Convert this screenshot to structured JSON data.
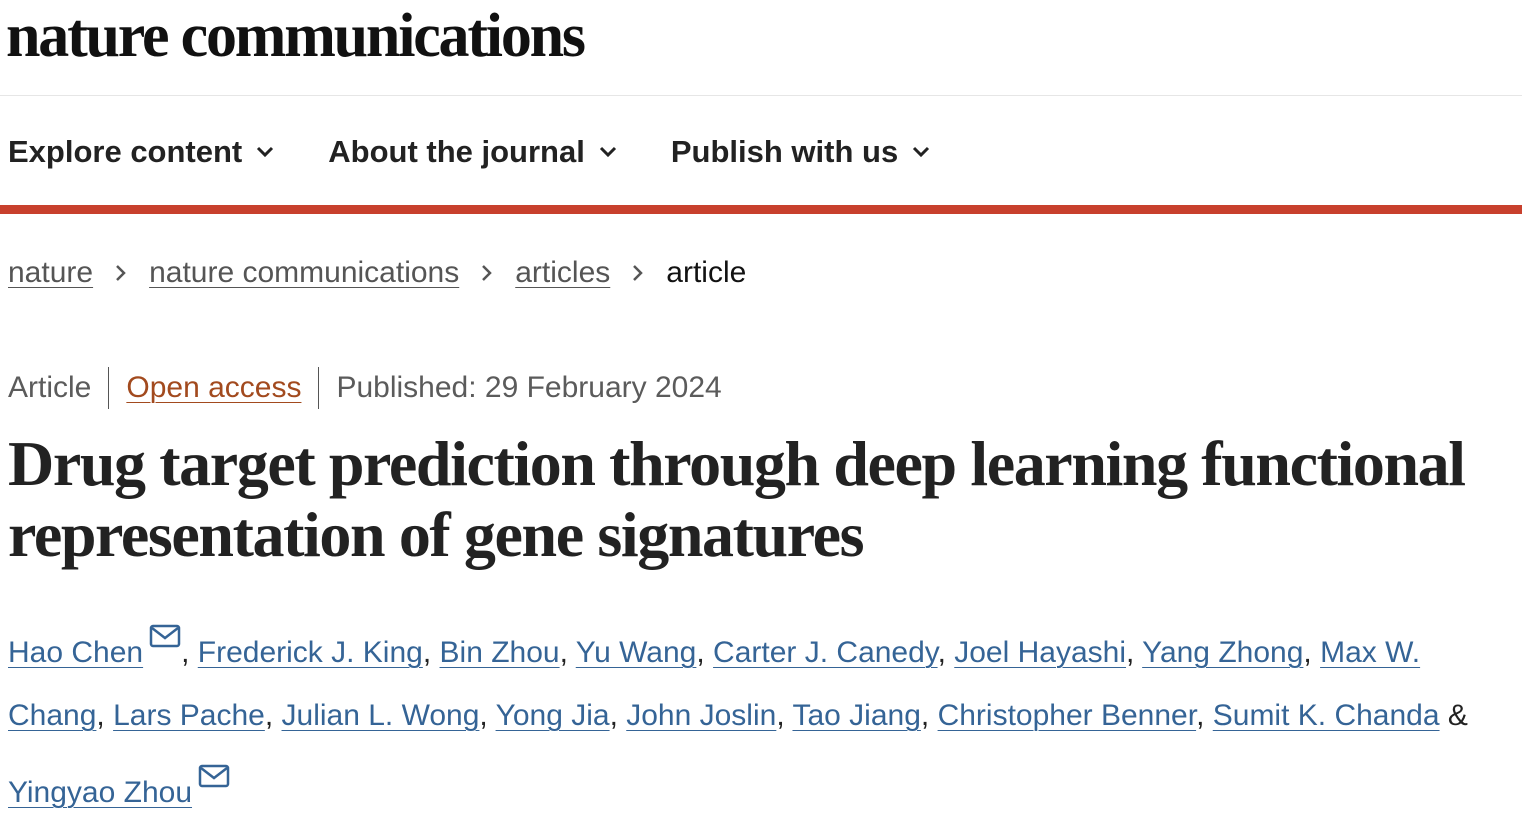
{
  "header": {
    "logo": "nature communications"
  },
  "nav": {
    "items": [
      {
        "label": "Explore content",
        "icon": "chevron-down-icon"
      },
      {
        "label": "About the journal",
        "icon": "chevron-down-icon"
      },
      {
        "label": "Publish with us",
        "icon": "chevron-down-icon"
      }
    ]
  },
  "accent_color": "#c8402d",
  "breadcrumb": {
    "items": [
      "nature",
      "nature communications",
      "articles"
    ],
    "current": "article",
    "separator_icon": "chevron-right-icon"
  },
  "meta": {
    "type": "Article",
    "access": "Open access",
    "published": "Published: 29 February 2024"
  },
  "article": {
    "title": "Drug target prediction through deep learning functional representation of gene signatures"
  },
  "authors": {
    "list": [
      "Hao Chen",
      "Frederick J. King",
      "Bin Zhou",
      "Yu Wang",
      "Carter J. Canedy",
      "Joel Hayashi",
      "Yang Zhong",
      "Max W. Chang",
      "Lars Pache",
      "Julian L. Wong",
      "Yong Jia",
      "John Joslin",
      "Tao Jiang",
      "Christopher Benner",
      "Sumit K. Chanda",
      "Yingyao Zhou"
    ],
    "ampersand": "&",
    "corresponding_icon": "mail-icon"
  }
}
